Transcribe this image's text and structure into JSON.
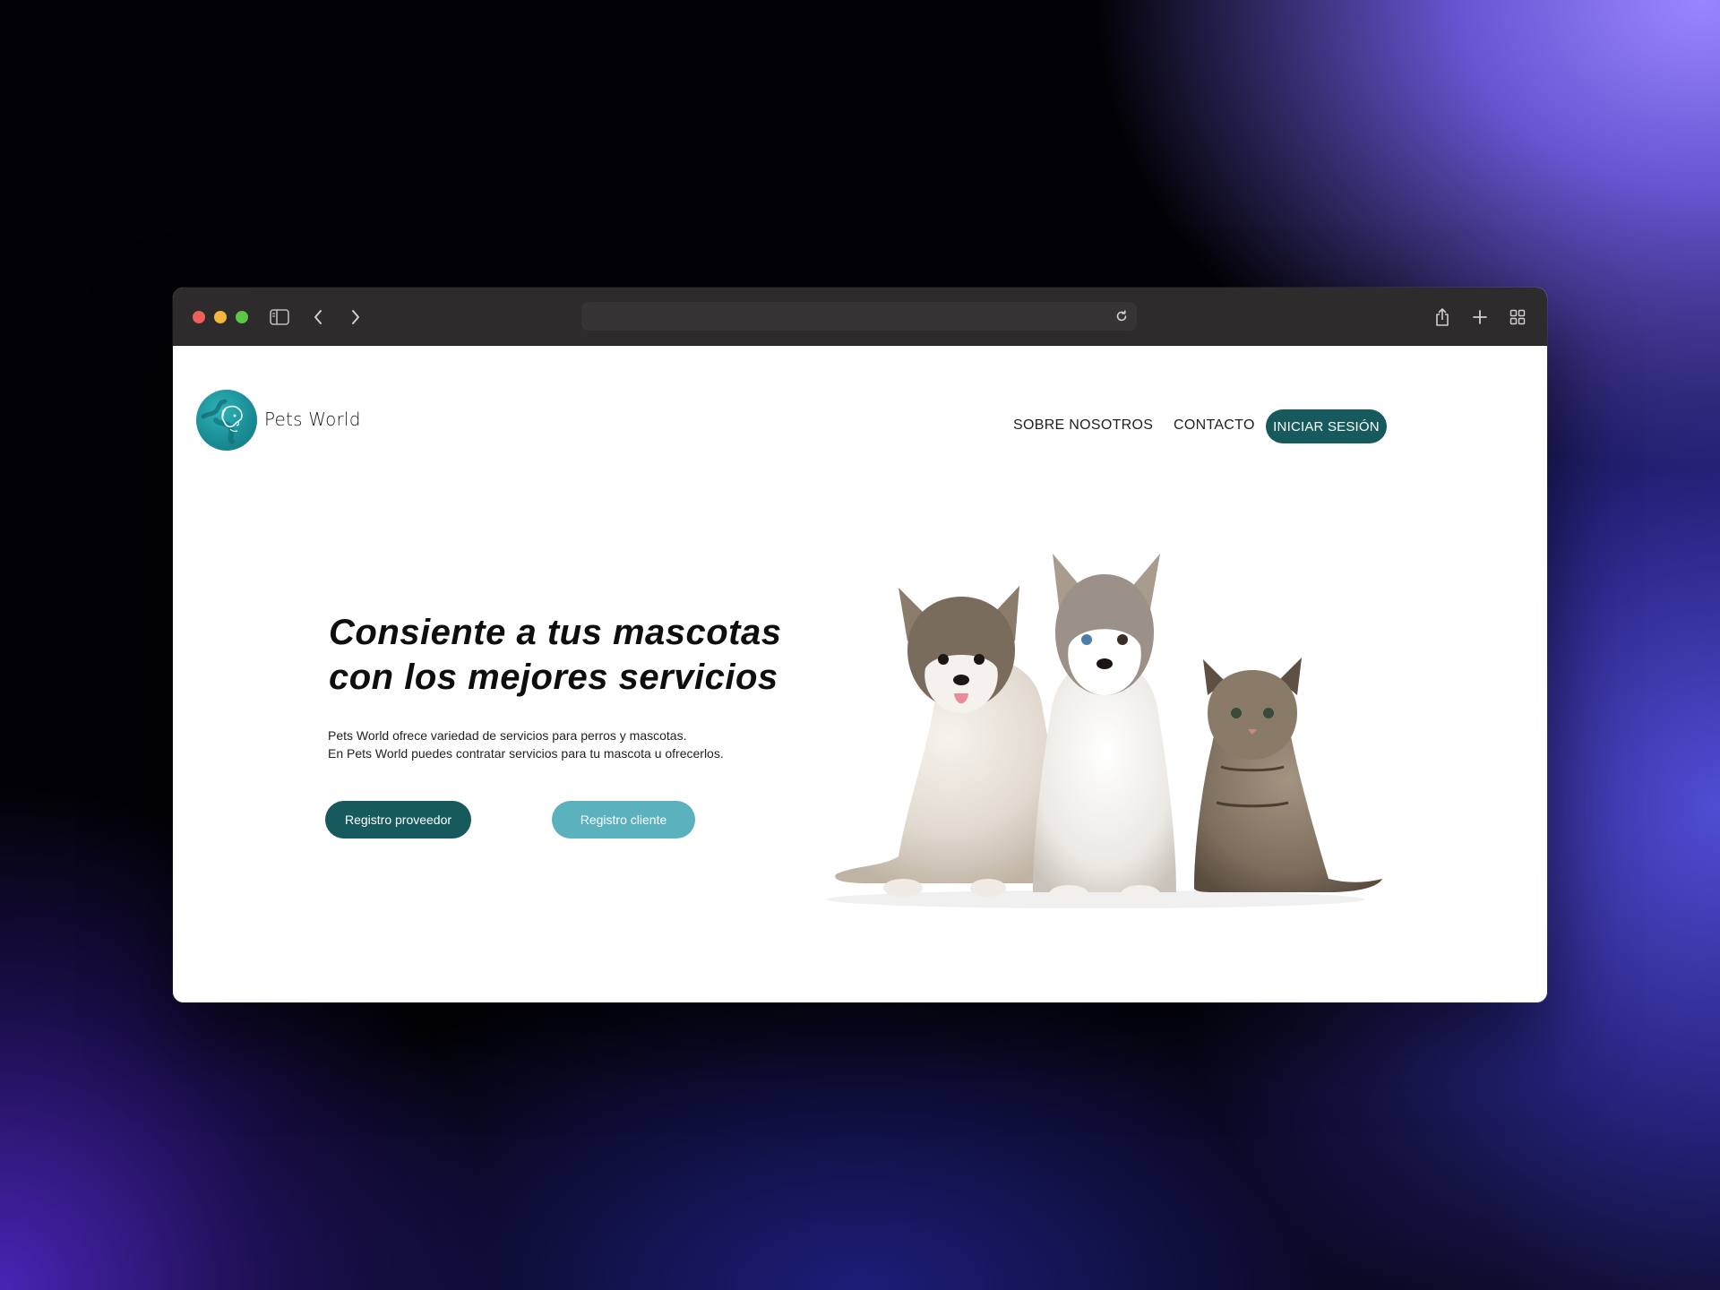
{
  "brand": {
    "name": "Pets World"
  },
  "nav": {
    "about": "SOBRE NOSOTROS",
    "contact": "CONTACTO",
    "login": "INICIAR SESIÓN"
  },
  "hero": {
    "headline_line1": "Consiente a tus mascotas",
    "headline_line2": "con los mejores servicios",
    "description_line1": "Pets World ofrece variedad de servicios para perros y mascotas.",
    "description_line2": "En Pets World puedes contratar servicios para tu mascota u ofrecerlos.",
    "provider_button": "Registro proveedor",
    "client_button": "Registro cliente",
    "image_subject": "two husky puppies and a tabby kitten"
  },
  "colors": {
    "primary": "#175a5e",
    "secondary": "#5bb2be",
    "logo": "#1b8e96",
    "window_chrome": "#2d2b2b"
  },
  "browser": {
    "icons": [
      "sidebar-icon",
      "back-icon",
      "forward-icon",
      "reload-icon",
      "share-icon",
      "new-tab-icon",
      "tab-overview-icon"
    ]
  }
}
